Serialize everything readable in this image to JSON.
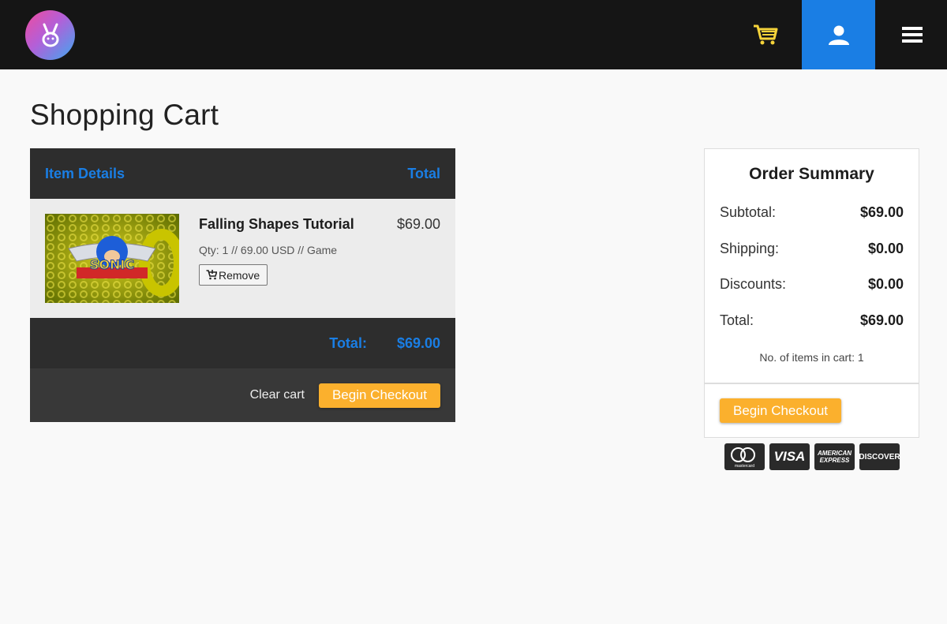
{
  "header": {
    "logo_icon": "rabbit-icon",
    "cart_icon": "shopping-cart-icon",
    "user_icon": "user-icon",
    "menu_icon": "hamburger-icon",
    "accent": "#1a7ee4"
  },
  "page": {
    "title": "Shopping Cart"
  },
  "cart": {
    "columns": [
      "Item Details",
      "Total"
    ],
    "items": [
      {
        "name": "Falling Shapes Tutorial",
        "price": "$69.00",
        "meta": "Qty: 1 // 69.00 USD // Game",
        "thumbnail_text": "SONIC",
        "remove_label": "Remove"
      }
    ],
    "total_label": "Total:",
    "total_value": "$69.00",
    "clear_label": "Clear cart",
    "checkout_label": "Begin Checkout"
  },
  "summary": {
    "title": "Order Summary",
    "rows": [
      {
        "label": "Subtotal:",
        "value": "$69.00"
      },
      {
        "label": "Shipping:",
        "value": "$0.00"
      },
      {
        "label": "Discounts:",
        "value": "$0.00"
      },
      {
        "label": "Total:",
        "value": "$69.00"
      }
    ],
    "items_count": "No. of items in cart: 1",
    "checkout_label": "Begin Checkout",
    "checkout_color": "#fbb02d"
  },
  "payment_cards": {
    "mastercard": "mastercard",
    "visa": "VISA",
    "amex_line1": "AMERICAN",
    "amex_line2": "EXPRESS",
    "discover": "DISCOVER"
  }
}
